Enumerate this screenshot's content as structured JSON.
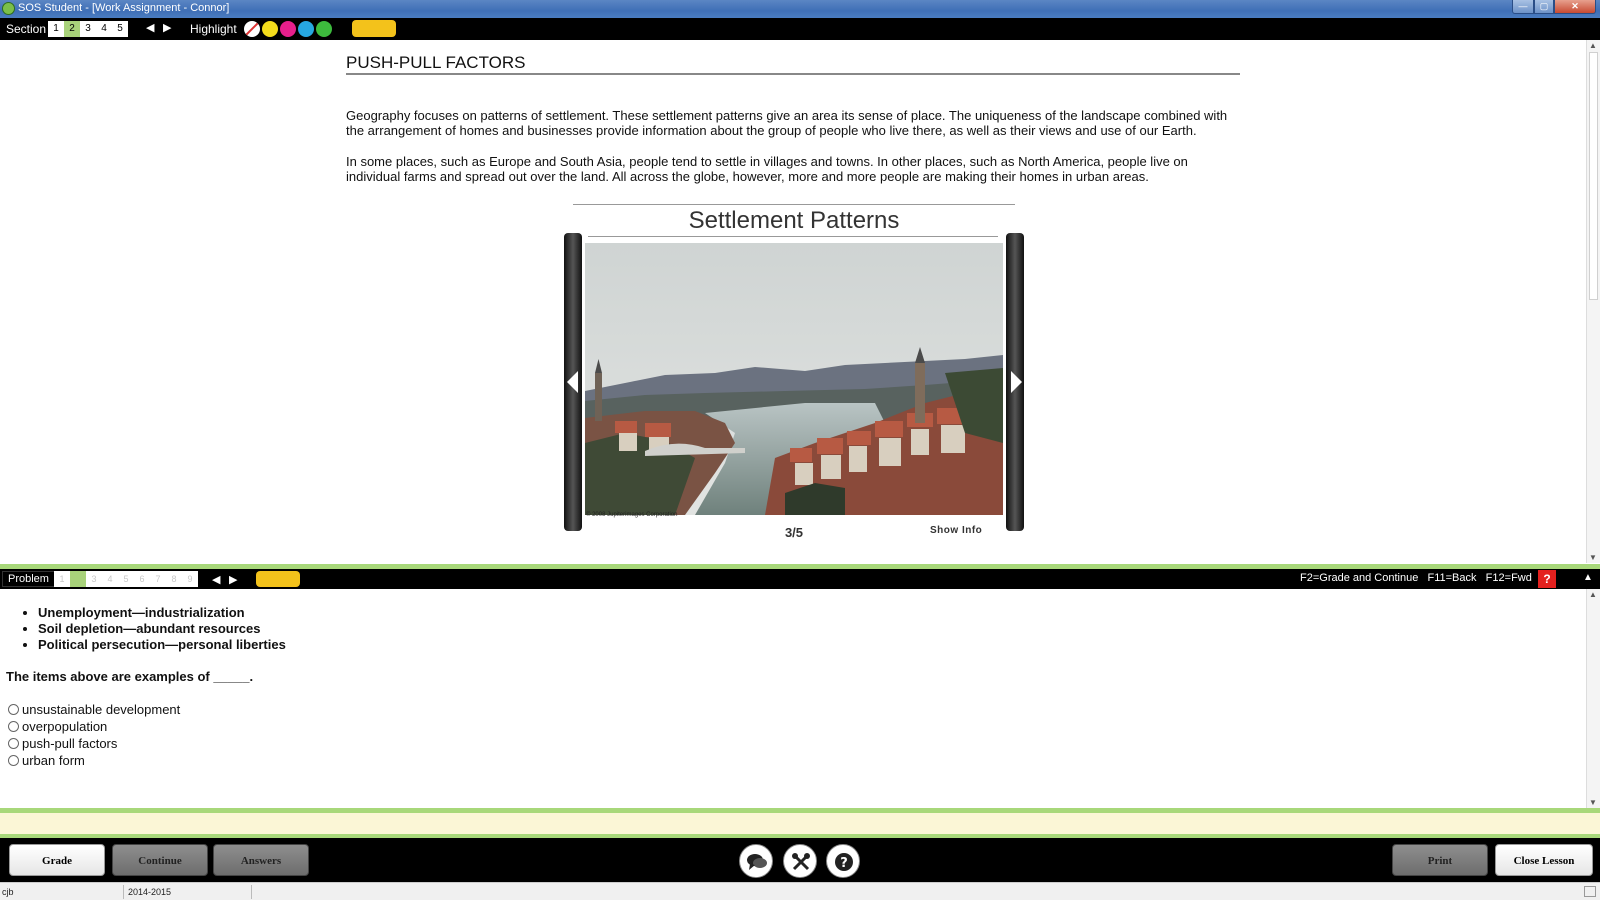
{
  "window": {
    "title": "SOS Student - [Work Assignment - Connor]",
    "min": "—",
    "max": "▢",
    "close": "✕"
  },
  "sectionbar": {
    "label": "Section",
    "sections": [
      "1",
      "2",
      "3",
      "4",
      "5"
    ],
    "active_section": "2",
    "prev": "◀",
    "next": "▶",
    "highlight_label": "Highlight",
    "colors": {
      "yellow": "#f3dc1b",
      "pink": "#e61f8c",
      "blue": "#27a7e1",
      "green": "#3dbb3d",
      "marker": "#f3c21b"
    }
  },
  "content": {
    "title": "PUSH-PULL FACTORS",
    "paragraphs": [
      "Geography focuses on patterns of settlement. These settlement patterns give an area its sense of place. The uniqueness of the landscape combined with the arrangement of homes and businesses provide information about the group of people who live there, as well as their views and use of our Earth.",
      "In some places, such as Europe and South Asia, people tend to settle in villages and towns. In other places, such as North America, people live on individual farms and spread out over the land. All across the globe, however, more and more people are making their homes in urban areas."
    ],
    "gallery": {
      "title": "Settlement Patterns",
      "credit": "© 2008 Jupiterimages Corporation",
      "count": "3/5",
      "show_info": "Show Info"
    }
  },
  "problembar": {
    "label": "Problem",
    "problems": [
      "1",
      "2",
      "3",
      "4",
      "5",
      "6",
      "7",
      "8",
      "9"
    ],
    "active_problem": "2",
    "prev": "◀",
    "next": "▶",
    "shortcuts": "F2=Grade and Continue   F11=Back   F12=Fwd",
    "help": "?",
    "collapse": "▲"
  },
  "problem": {
    "bullets": [
      "Unemployment—industrialization",
      "Soil depletion—abundant resources",
      "Political persecution—personal liberties"
    ],
    "question": "The items above are examples of _____.",
    "options": [
      "unsustainable development",
      "overpopulation",
      "push-pull factors",
      "urban form"
    ]
  },
  "bottombar": {
    "grade": "Grade",
    "continue": "Continue",
    "answers": "Answers",
    "print": "Print",
    "close_lesson": "Close Lesson",
    "icons": [
      "chat-icon",
      "tools-icon",
      "help-icon"
    ]
  },
  "statusbar": {
    "user": "cjb",
    "year": "2014-2015"
  }
}
